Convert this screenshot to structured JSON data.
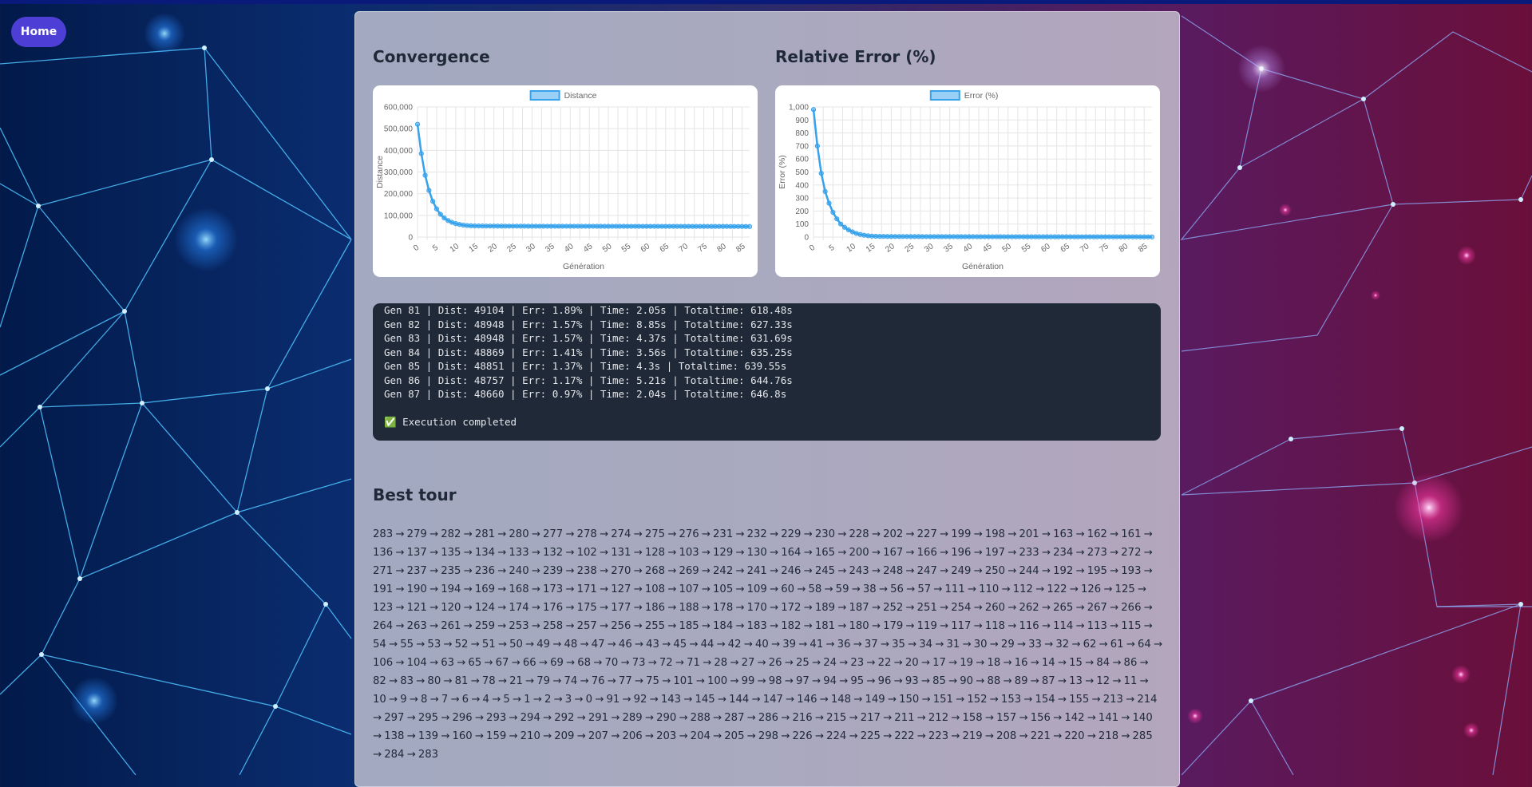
{
  "nav": {
    "home_label": "Home"
  },
  "sections": {
    "convergence_title": "Convergence",
    "error_title": "Relative Error (%)",
    "best_tour_title": "Best tour"
  },
  "colors": {
    "series": "#36a2eb",
    "series_fill": "rgba(54,162,235,0.5)",
    "console_bg": "#1f2937",
    "home_button": "#4d3fd6"
  },
  "chart_data": [
    {
      "type": "line",
      "legend": "Distance",
      "xlabel": "Génération",
      "ylabel": "Distance",
      "xlim": [
        0,
        87
      ],
      "ylim": [
        0,
        600000
      ],
      "yticks": [
        "0",
        "100,000",
        "200,000",
        "300,000",
        "400,000",
        "500,000",
        "600,000"
      ],
      "ytick_values": [
        0,
        100000,
        200000,
        300000,
        400000,
        500000,
        600000
      ],
      "xticks": [
        0,
        5,
        10,
        15,
        20,
        25,
        30,
        35,
        40,
        45,
        50,
        55,
        60,
        65,
        70,
        75,
        80,
        85
      ],
      "series": [
        {
          "name": "Distance",
          "x": [
            0,
            1,
            2,
            3,
            4,
            5,
            6,
            7,
            8,
            9,
            10,
            11,
            12,
            13,
            14,
            15,
            16,
            17,
            18,
            19,
            20,
            21,
            22,
            23,
            24,
            25,
            26,
            27,
            28,
            29,
            30,
            31,
            32,
            33,
            34,
            35,
            36,
            37,
            38,
            39,
            40,
            41,
            42,
            43,
            44,
            45,
            46,
            47,
            48,
            49,
            50,
            51,
            52,
            53,
            54,
            55,
            56,
            57,
            58,
            59,
            60,
            61,
            62,
            63,
            64,
            65,
            66,
            67,
            68,
            69,
            70,
            71,
            72,
            73,
            74,
            75,
            76,
            77,
            78,
            79,
            80,
            81,
            82,
            83,
            84,
            85,
            86,
            87
          ],
          "y": [
            520000,
            385000,
            285000,
            215000,
            165000,
            130000,
            105000,
            88000,
            76000,
            68000,
            62000,
            58000,
            55000,
            53000,
            52000,
            51500,
            51200,
            51000,
            50900,
            50800,
            50700,
            50600,
            50500,
            50450,
            50400,
            50350,
            50300,
            50250,
            50200,
            50150,
            50100,
            50050,
            50000,
            49980,
            49960,
            49940,
            49920,
            49900,
            49880,
            49860,
            49840,
            49820,
            49800,
            49780,
            49760,
            49740,
            49720,
            49700,
            49680,
            49660,
            49640,
            49620,
            49600,
            49580,
            49560,
            49540,
            49520,
            49500,
            49480,
            49460,
            49440,
            49420,
            49400,
            49380,
            49360,
            49340,
            49320,
            49300,
            49280,
            49260,
            49240,
            49220,
            49200,
            49180,
            49160,
            49140,
            49120,
            49110,
            49108,
            49106,
            49105,
            49104,
            48948,
            48948,
            48869,
            48851,
            48757,
            48660
          ]
        }
      ]
    },
    {
      "type": "line",
      "legend": "Error (%)",
      "xlabel": "Génération",
      "ylabel": "Error (%)",
      "xlim": [
        0,
        87
      ],
      "ylim": [
        0,
        1000
      ],
      "yticks": [
        "0",
        "100",
        "200",
        "300",
        "400",
        "500",
        "600",
        "700",
        "800",
        "900",
        "1,000"
      ],
      "ytick_values": [
        0,
        100,
        200,
        300,
        400,
        500,
        600,
        700,
        800,
        900,
        1000
      ],
      "xticks": [
        0,
        5,
        10,
        15,
        20,
        25,
        30,
        35,
        40,
        45,
        50,
        55,
        60,
        65,
        70,
        75,
        80,
        85
      ],
      "series": [
        {
          "name": "Error (%)",
          "x": [
            0,
            1,
            2,
            3,
            4,
            5,
            6,
            7,
            8,
            9,
            10,
            11,
            12,
            13,
            14,
            15,
            16,
            17,
            18,
            19,
            20,
            21,
            22,
            23,
            24,
            25,
            26,
            27,
            28,
            29,
            30,
            31,
            32,
            33,
            34,
            35,
            36,
            37,
            38,
            39,
            40,
            41,
            42,
            43,
            44,
            45,
            46,
            47,
            48,
            49,
            50,
            51,
            52,
            53,
            54,
            55,
            56,
            57,
            58,
            59,
            60,
            61,
            62,
            63,
            64,
            65,
            66,
            67,
            68,
            69,
            70,
            71,
            72,
            73,
            74,
            75,
            76,
            77,
            78,
            79,
            80,
            81,
            82,
            83,
            84,
            85,
            86,
            87
          ],
          "y": [
            980,
            700,
            490,
            350,
            260,
            190,
            140,
            100,
            75,
            55,
            40,
            28,
            20,
            14,
            10,
            7,
            6,
            5,
            5,
            4.5,
            4.4,
            4.3,
            4.2,
            4.1,
            4.0,
            3.9,
            3.8,
            3.7,
            3.6,
            3.5,
            3.4,
            3.35,
            3.3,
            3.25,
            3.2,
            3.15,
            3.1,
            3.05,
            3.0,
            2.95,
            2.9,
            2.85,
            2.8,
            2.75,
            2.7,
            2.65,
            2.6,
            2.55,
            2.5,
            2.45,
            2.4,
            2.38,
            2.36,
            2.34,
            2.32,
            2.3,
            2.28,
            2.26,
            2.24,
            2.22,
            2.2,
            2.18,
            2.16,
            2.14,
            2.12,
            2.1,
            2.08,
            2.06,
            2.04,
            2.02,
            2.0,
            1.98,
            1.96,
            1.95,
            1.94,
            1.93,
            1.92,
            1.91,
            1.9,
            1.9,
            1.89,
            1.89,
            1.57,
            1.57,
            1.41,
            1.37,
            1.17,
            0.97
          ]
        }
      ]
    }
  ],
  "console": {
    "lines": [
      "Gen 81 | Dist: 49104 | Err: 1.89% | Time: 2.05s | Totaltime: 618.48s",
      "Gen 82 | Dist: 48948 | Err: 1.57% | Time: 8.85s | Totaltime: 627.33s",
      "Gen 83 | Dist: 48948 | Err: 1.57% | Time: 4.37s | Totaltime: 631.69s",
      "Gen 84 | Dist: 48869 | Err: 1.41% | Time: 3.56s | Totaltime: 635.25s",
      "Gen 85 | Dist: 48851 | Err: 1.37% | Time: 4.3s | Totaltime: 639.55s",
      "Gen 86 | Dist: 48757 | Err: 1.17% | Time: 5.21s | Totaltime: 644.76s",
      "Gen 87 | Dist: 48660 | Err: 0.97% | Time: 2.04s | Totaltime: 646.8s"
    ],
    "completed": "✅ Execution completed"
  },
  "best_tour": "283 → 279 → 282 → 281 → 280 → 277 → 278 → 274 → 275 → 276 → 231 → 232 → 229 → 230 → 228 → 202 → 227 → 199 → 198 → 201 → 163 → 162 → 161 → 136 → 137 → 135 → 134 → 133 → 132 → 102 → 131 → 128 → 103 → 129 → 130 → 164 → 165 → 200 → 167 → 166 → 196 → 197 → 233 → 234 → 273 → 272 → 271 → 237 → 235 → 236 → 240 → 239 → 238 → 270 → 268 → 269 → 242 → 241 → 246 → 245 → 243 → 248 → 247 → 249 → 250 → 244 → 192 → 195 → 193 → 191 → 190 → 194 → 169 → 168 → 173 → 171 → 127 → 108 → 107 → 105 → 109 → 60 → 58 → 59 → 38 → 56 → 57 → 111 → 110 → 112 → 122 → 126 → 125 → 123 → 121 → 120 → 124 → 174 → 176 → 175 → 177 → 186 → 188 → 178 → 170 → 172 → 189 → 187 → 252 → 251 → 254 → 260 → 262 → 265 → 267 → 266 → 264 → 263 → 261 → 259 → 253 → 258 → 257 → 256 → 255 → 185 → 184 → 183 → 182 → 181 → 180 → 179 → 119 → 117 → 118 → 116 → 114 → 113 → 115 → 54 → 55 → 53 → 52 → 51 → 50 → 49 → 48 → 47 → 46 → 43 → 45 → 44 → 42 → 40 → 39 → 41 → 36 → 37 → 35 → 34 → 31 → 30 → 29 → 33 → 32 → 62 → 61 → 64 → 106 → 104 → 63 → 65 → 67 → 66 → 69 → 68 → 70 → 73 → 72 → 71 → 28 → 27 → 26 → 25 → 24 → 23 → 22 → 20 → 17 → 19 → 18 → 16 → 14 → 15 → 84 → 86 → 82 → 83 → 80 → 81 → 78 → 21 → 79 → 74 → 76 → 77 → 75 → 101 → 100 → 99 → 98 → 97 → 94 → 95 → 96 → 93 → 85 → 90 → 88 → 89 → 87 → 13 → 12 → 11 → 10 → 9 → 8 → 7 → 6 → 4 → 5 → 1 → 2 → 3 → 0 → 91 → 92 → 143 → 145 → 144 → 147 → 146 → 148 → 149 → 150 → 151 → 152 → 153 → 154 → 155 → 213 → 214 → 297 → 295 → 296 → 293 → 294 → 292 → 291 → 289 → 290 → 288 → 287 → 286 → 216 → 215 → 217 → 211 → 212 → 158 → 157 → 156 → 142 → 141 → 140 → 138 → 139 → 160 → 159 → 210 → 209 → 207 → 206 → 203 → 204 → 205 → 298 → 226 → 224 → 225 → 222 → 223 → 219 → 208 → 221 → 220 → 218 → 285 → 284 → 283"
}
